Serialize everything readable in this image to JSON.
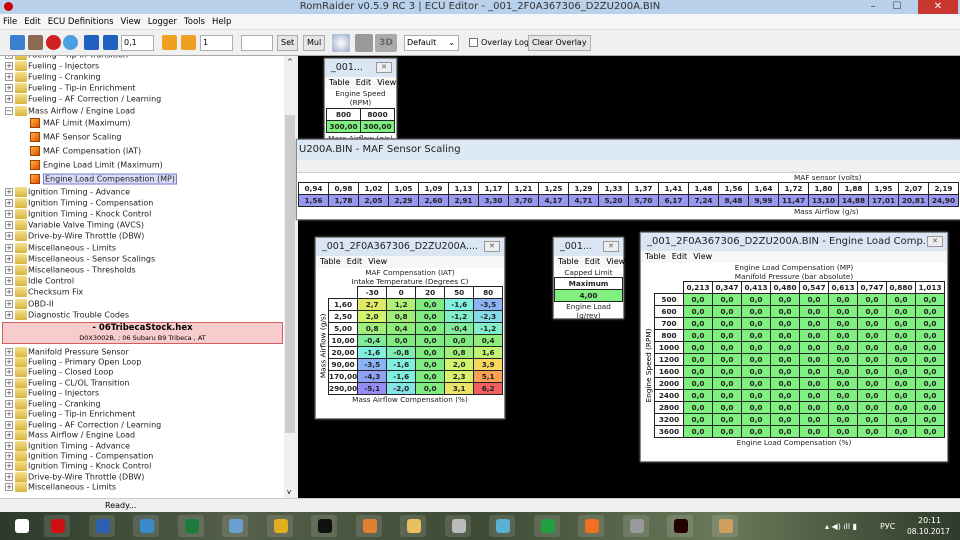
{
  "window": {
    "title": "RomRaider v0.5.9 RC 3 | ECU Editor - _001_2F0A367306_D2ZU200A.BIN",
    "minimize": "–",
    "maximize": "☐",
    "close": "✕"
  },
  "menu": [
    "File",
    "Edit",
    "ECU Definitions",
    "View",
    "Logger",
    "Tools",
    "Help"
  ],
  "toolbar": {
    "increment_fine": "0,1",
    "increment_coarse": "1",
    "set_value": "",
    "set_label": "Set",
    "mul_label": "Mul",
    "three_d_label": "3D",
    "palette_select": "Default",
    "overlay_log_label": "Overlay Log",
    "overlay_log_checked": false,
    "clear_overlay_label": "Clear Overlay"
  },
  "tree": {
    "items_top": [
      {
        "label": "Fueling - Tip-in Transition",
        "type": "folder"
      },
      {
        "label": "Fueling - Injectors",
        "type": "folder"
      },
      {
        "label": "Fueling - Cranking",
        "type": "folder"
      },
      {
        "label": "Fueling - Tip-in Enrichment",
        "type": "folder"
      },
      {
        "label": "Fueling - AF Correction / Learning",
        "type": "folder"
      },
      {
        "label": "Mass Airflow / Engine Load",
        "type": "folder",
        "expanded": true
      },
      {
        "label": "MAF Limit (Maximum)",
        "type": "table"
      },
      {
        "label": "MAF Sensor Scaling",
        "type": "table"
      },
      {
        "label": "MAF Compensation (IAT)",
        "type": "table3d"
      },
      {
        "label": "Engine Load Limit (Maximum)",
        "type": "table"
      },
      {
        "label": "Engine Load Compensation (MP)",
        "type": "table3d",
        "selected": true
      },
      {
        "label": "Ignition Timing - Advance",
        "type": "folder"
      },
      {
        "label": "Ignition Timing - Compensation",
        "type": "folder"
      },
      {
        "label": "Ignition Timing - Knock Control",
        "type": "folder"
      },
      {
        "label": "Variable Valve Timing (AVCS)",
        "type": "folder"
      },
      {
        "label": "Drive-by-Wire Throttle (DBW)",
        "type": "folder"
      },
      {
        "label": "Miscellaneous - Limits",
        "type": "folder"
      },
      {
        "label": "Miscellaneous - Sensor Scalings",
        "type": "folder"
      },
      {
        "label": "Miscellaneous - Thresholds",
        "type": "folder"
      },
      {
        "label": "Idle Control",
        "type": "folder"
      },
      {
        "label": "Checksum Fix",
        "type": "folder"
      },
      {
        "label": "OBD-II",
        "type": "folder"
      },
      {
        "label": "Diagnostic Trouble Codes",
        "type": "folder"
      }
    ],
    "rom2": {
      "name": "- 06TribecaStock.hex",
      "info": "D0X3002B, ; 06 Subaru B9 Tribeca , AT"
    },
    "items_bottom": [
      {
        "label": "Manifold Pressure Sensor",
        "type": "folder"
      },
      {
        "label": "Fueling - Primary Open Loop",
        "type": "folder"
      },
      {
        "label": "Fueling - Closed Loop",
        "type": "folder"
      },
      {
        "label": "Fueling - CL/OL Transition",
        "type": "folder"
      },
      {
        "label": "Fueling - Injectors",
        "type": "folder"
      },
      {
        "label": "Fueling - Cranking",
        "type": "folder"
      },
      {
        "label": "Fueling - Tip-in Enrichment",
        "type": "folder"
      },
      {
        "label": "Fueling - AF Correction / Learning",
        "type": "folder"
      },
      {
        "label": "Mass Airflow / Engine Load",
        "type": "folder"
      },
      {
        "label": "Ignition Timing - Advance",
        "type": "folder"
      },
      {
        "label": "Ignition Timing - Compensation",
        "type": "folder"
      },
      {
        "label": "Ignition Timing - Knock Control",
        "type": "folder"
      },
      {
        "label": "Drive-by-Wire Throttle (DBW)",
        "type": "folder"
      },
      {
        "label": "Miscellaneous - Limits",
        "type": "folder"
      }
    ]
  },
  "status": "Ready...",
  "table_menu": [
    "Table",
    "Edit",
    "View"
  ],
  "maf_limit": {
    "title": "_001...",
    "x_label": "Engine Speed (RPM)",
    "x": [
      "800",
      "8000"
    ],
    "values": [
      "300,00",
      "300,00"
    ],
    "y_label": "Mass Airflow (g/s)"
  },
  "maf_scaling": {
    "title": "U200A.BIN - MAF Sensor Scaling",
    "x_label": "MAF sensor (volts)",
    "x": [
      "0,94",
      "0,98",
      "1,02",
      "1,05",
      "1,09",
      "1,13",
      "1,17",
      "1,21",
      "1,25",
      "1,29",
      "1,33",
      "1,37",
      "1,41",
      "1,48",
      "1,56",
      "1,64",
      "1,72",
      "1,80",
      "1,88",
      "1,95",
      "2,07",
      "2,19"
    ],
    "values": [
      "1,56",
      "1,78",
      "2,05",
      "2,29",
      "2,60",
      "2,91",
      "3,30",
      "3,70",
      "4,17",
      "4,71",
      "5,20",
      "5,70",
      "6,17",
      "7,24",
      "8,48",
      "9,99",
      "11,47",
      "13,10",
      "14,88",
      "17,01",
      "20,81",
      "24,90"
    ],
    "y_label": "Mass Airflow (g/s)"
  },
  "maf_comp": {
    "title": "_001_2F0A367306_D2ZU200A....",
    "name": "MAF Compensation (IAT)",
    "x_label": "Intake Temperature (Degrees C)",
    "x": [
      "-30",
      "0",
      "20",
      "50",
      "80"
    ],
    "y_label": "Mass Airflow (g/s)",
    "y": [
      "1,60",
      "2,50",
      "5,00",
      "10,00",
      "20,00",
      "90,00",
      "170,00",
      "290,00"
    ],
    "values": [
      [
        "2,7",
        "1,2",
        "0,0",
        "-1,6",
        "-3,5"
      ],
      [
        "2,0",
        "0,8",
        "0,0",
        "-1,2",
        "-2,3"
      ],
      [
        "0,8",
        "0,4",
        "0,0",
        "-0,4",
        "-1,2"
      ],
      [
        "-0,4",
        "0,0",
        "0,0",
        "0,0",
        "0,4"
      ],
      [
        "-1,6",
        "-0,8",
        "0,0",
        "0,8",
        "1,6"
      ],
      [
        "-3,5",
        "-1,6",
        "0,0",
        "2,0",
        "3,9"
      ],
      [
        "-4,3",
        "-1,6",
        "0,0",
        "2,3",
        "5,1"
      ],
      [
        "-5,1",
        "-2,0",
        "0,0",
        "3,1",
        "6,2"
      ]
    ],
    "z_label": "Mass Airflow Compensation (%)"
  },
  "load_limit": {
    "title": "_001...",
    "x_label": "Capped Limit",
    "x": [
      "Maximum"
    ],
    "values": [
      "4,00"
    ],
    "y_label": "Engine Load (g/rev)"
  },
  "load_comp": {
    "title": "_001_2F0A367306_D2ZU200A.BIN - Engine Load Comp...",
    "name": "Engine Load Compensation (MP)",
    "x_label": "Manifold Pressure (bar absolute)",
    "x": [
      "0,213",
      "0,347",
      "0,413",
      "0,480",
      "0,547",
      "0,613",
      "0,747",
      "0,880",
      "1,013"
    ],
    "y_label": "Engine Speed (RPM)",
    "y": [
      "500",
      "600",
      "700",
      "800",
      "1000",
      "1200",
      "1600",
      "2000",
      "2400",
      "2800",
      "3200",
      "3600"
    ],
    "cell_value": "0,0",
    "z_label": "Engine Load Compensation (%)"
  },
  "colors": {
    "zero_cell": "#80f080",
    "axis_cell": "#ffffff",
    "scaling_cell": "#9898f0",
    "pink_rom": "#f8cccc",
    "desktop": "#000000"
  },
  "taskbar": {
    "icons": [
      "windows-start",
      "opera",
      "word",
      "disc-burner",
      "excel",
      "calculator",
      "chrome",
      "pidgin",
      "maps",
      "file-explorer",
      "weather",
      "flash-drive",
      "globe",
      "firefox",
      "keyboard",
      "romraider",
      "paint"
    ],
    "language": "РУС",
    "time": "20:11",
    "date": "08.10.2017"
  }
}
